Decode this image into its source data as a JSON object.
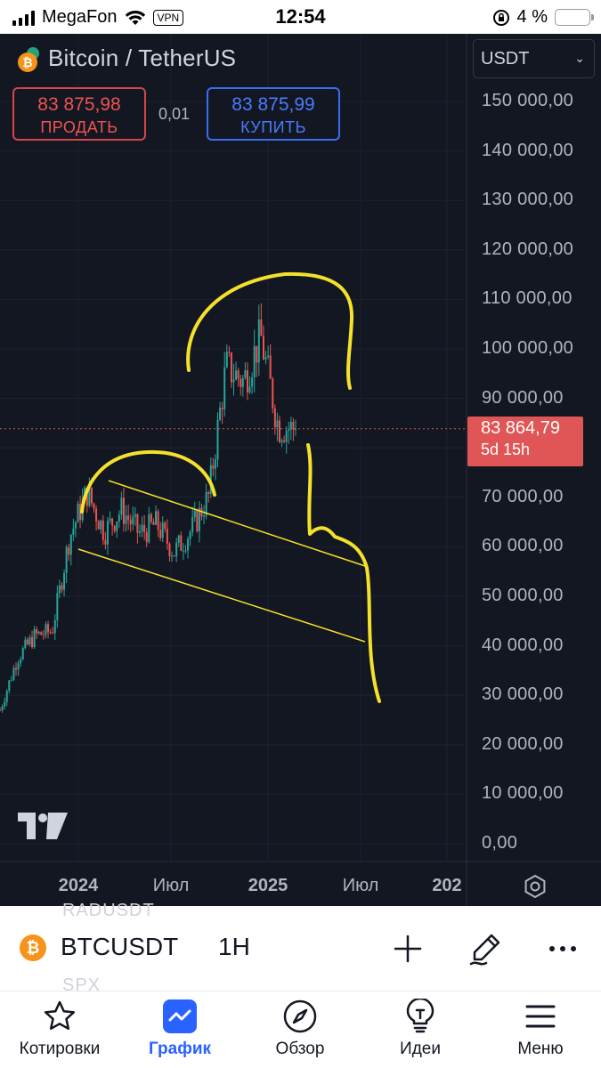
{
  "status_bar": {
    "carrier": "MegaFon",
    "vpn": "VPN",
    "time": "12:54",
    "battery": "4 %"
  },
  "header": {
    "title": "Bitcoin / TetherUS",
    "currency": "USDT",
    "sell": {
      "price": "83 875,98",
      "label": "ПРОДАТЬ"
    },
    "buy": {
      "price": "83 875,99",
      "label": "КУПИТЬ"
    },
    "spread": "0,01"
  },
  "colors": {
    "background": "#131722",
    "up": "#26a69a",
    "down": "#ef5350",
    "sell": "#ef5350",
    "buy": "#2962ff",
    "annotation": "#f5e12b",
    "active_nav": "#2962ff"
  },
  "chart_data": {
    "type": "candlestick",
    "y_ticks": [
      "150 000,00",
      "140 000,00",
      "130 000,00",
      "120 000,00",
      "110 000,00",
      "100 000,00",
      "90 000,00",
      "80 000,00",
      "70 000,00",
      "60 000,00",
      "50 000,00",
      "40 000,00",
      "30 000,00",
      "20 000,00",
      "10 000,00",
      "0,00"
    ],
    "ylim": [
      0,
      150000
    ],
    "x_ticks": [
      {
        "label": "2024",
        "bold": true
      },
      {
        "label": "Июл",
        "bold": false
      },
      {
        "label": "2025",
        "bold": true
      },
      {
        "label": "Июл",
        "bold": false
      },
      {
        "label": "202",
        "bold": true
      }
    ],
    "last_price": {
      "value": "83 864,79",
      "countdown": "5d 15h",
      "numeric": 83864.79
    },
    "approx_closes": [
      {
        "period": "2023-10",
        "value": 27000
      },
      {
        "period": "2023-11",
        "value": 37500
      },
      {
        "period": "2023-12",
        "value": 42000
      },
      {
        "period": "2024-01",
        "value": 43000
      },
      {
        "period": "2024-02",
        "value": 62000
      },
      {
        "period": "2024-03",
        "value": 71000
      },
      {
        "period": "2024-04",
        "value": 63000
      },
      {
        "period": "2024-05",
        "value": 67500
      },
      {
        "period": "2024-06",
        "value": 62700
      },
      {
        "period": "2024-07",
        "value": 64600
      },
      {
        "period": "2024-08",
        "value": 58900
      },
      {
        "period": "2024-09",
        "value": 63300
      },
      {
        "period": "2024-10",
        "value": 70200
      },
      {
        "period": "2024-11",
        "value": 96400
      },
      {
        "period": "2024-12",
        "value": 93400
      },
      {
        "period": "2025-01",
        "value": 102400
      },
      {
        "period": "2025-02",
        "value": 84300
      },
      {
        "period": "2025-03",
        "value": 83865
      }
    ],
    "grid": true
  },
  "toolbar": {
    "ghost_top": "RADUSDT",
    "ghost_bottom": "SPX",
    "symbol": "BTCUSDT",
    "timeframe": "1H",
    "coin_glyph": "₿"
  },
  "nav": {
    "quotes": "Котировки",
    "chart": "График",
    "overview": "Обзор",
    "ideas": "Идеи",
    "menu": "Меню"
  }
}
